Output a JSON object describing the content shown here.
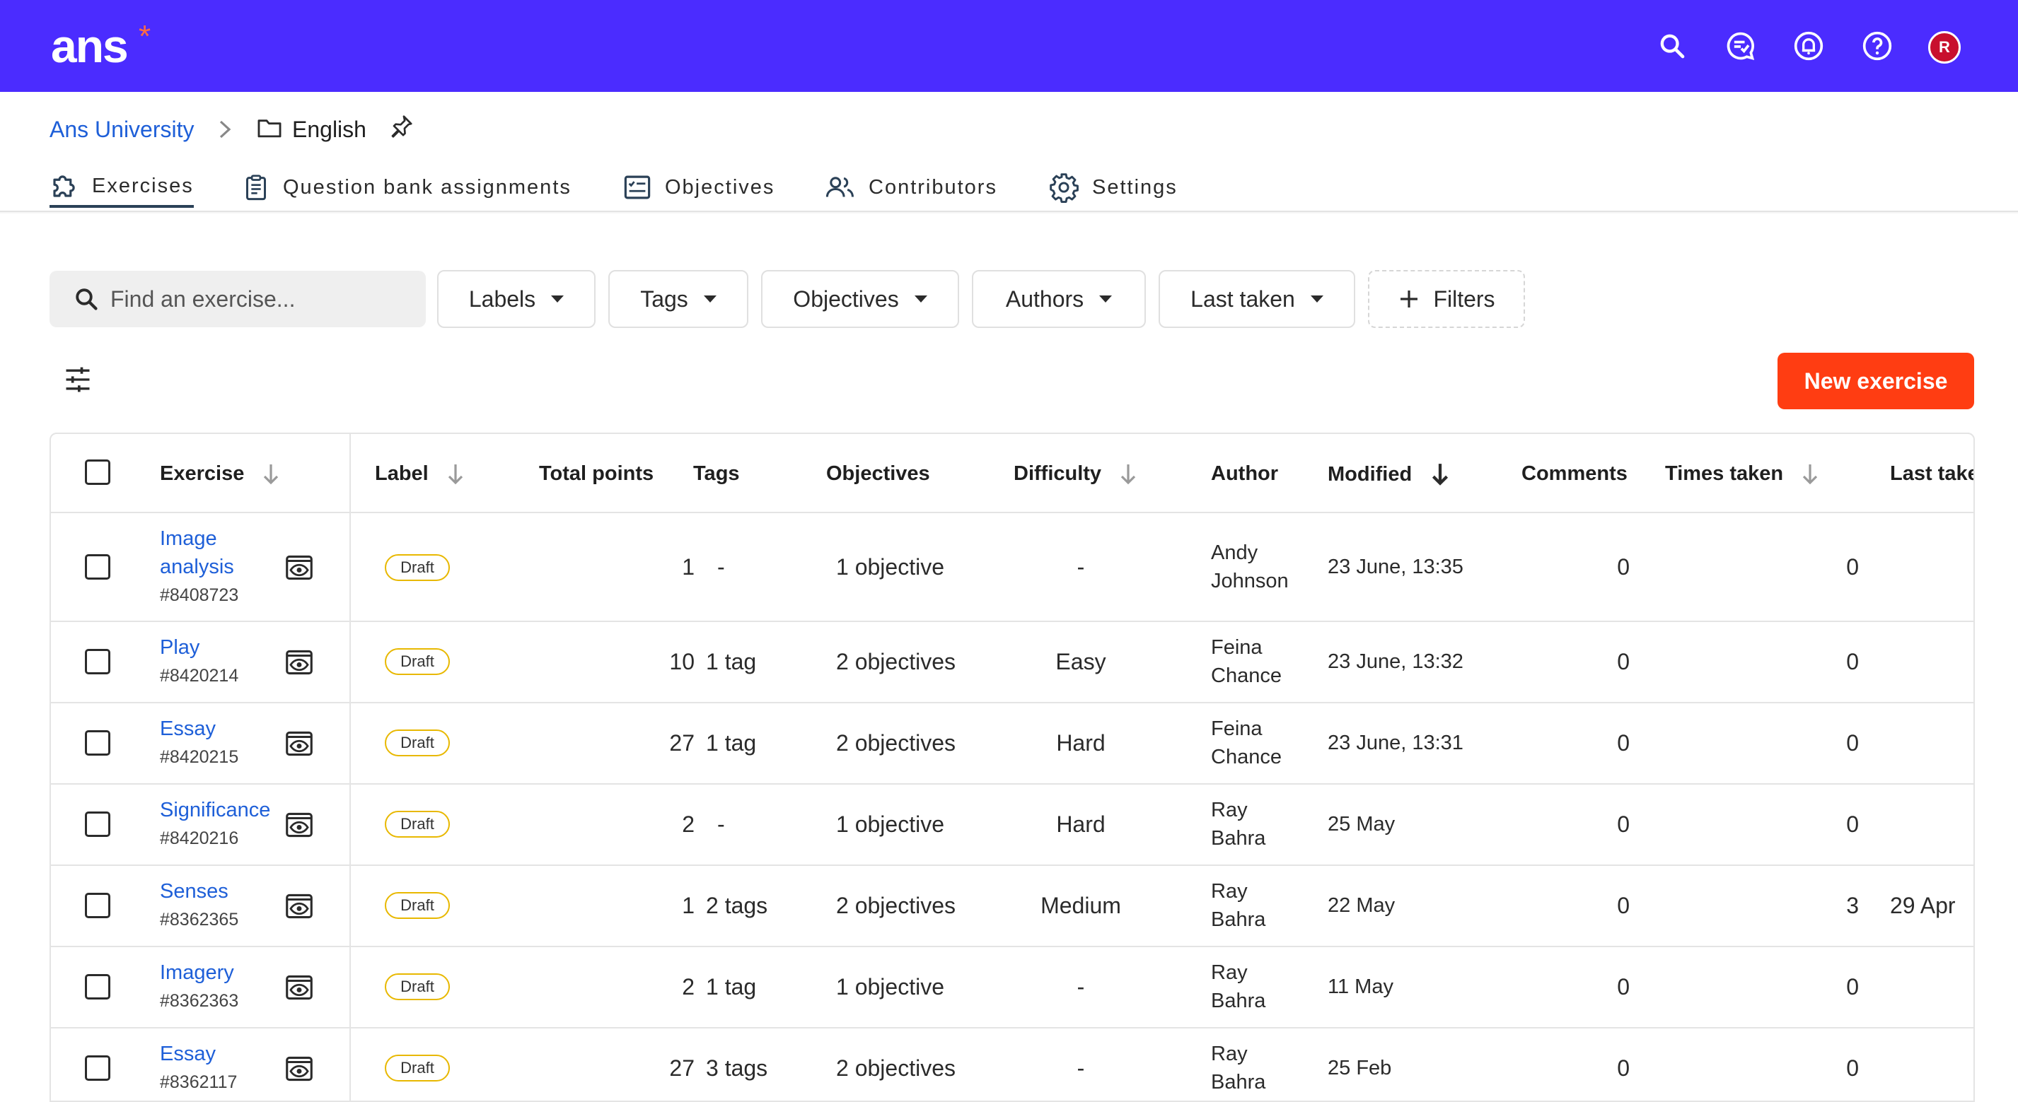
{
  "app": {
    "logo": "ans",
    "logo_mark": "*",
    "user_initial": "R"
  },
  "breadcrumb": {
    "parent": "Ans University",
    "current": "English"
  },
  "tabs": [
    {
      "label": "Exercises",
      "icon": "puzzle-icon",
      "active": true
    },
    {
      "label": "Question bank assignments",
      "icon": "clipboard-icon",
      "active": false
    },
    {
      "label": "Objectives",
      "icon": "checklist-icon",
      "active": false
    },
    {
      "label": "Contributors",
      "icon": "people-icon",
      "active": false
    },
    {
      "label": "Settings",
      "icon": "gear-icon",
      "active": false
    }
  ],
  "search": {
    "placeholder": "Find an exercise..."
  },
  "filters": [
    "Labels",
    "Tags",
    "Objectives",
    "Authors",
    "Last taken",
    "Filters"
  ],
  "new_exercise_label": "New exercise",
  "table": {
    "headers": {
      "exercise": "Exercise",
      "label": "Label",
      "total_points": "Total points",
      "tags": "Tags",
      "objectives": "Objectives",
      "difficulty": "Difficulty",
      "author": "Author",
      "modified": "Modified",
      "comments": "Comments",
      "times_taken": "Times taken",
      "last_taken": "Last take"
    },
    "rows": [
      {
        "title": "Image analysis",
        "id": "#8408723",
        "label": "Draft",
        "points": "1",
        "tags": "-",
        "objectives": "1 objective",
        "difficulty": "-",
        "author": "Andy Johnson",
        "modified": "23 June, 13:35",
        "comments": "0",
        "times_taken": "0",
        "last_taken": ""
      },
      {
        "title": "Play",
        "id": "#8420214",
        "label": "Draft",
        "points": "10",
        "tags": "1 tag",
        "objectives": "2 objectives",
        "difficulty": "Easy",
        "author": "Feina Chance",
        "modified": "23 June, 13:32",
        "comments": "0",
        "times_taken": "0",
        "last_taken": ""
      },
      {
        "title": "Essay",
        "id": "#8420215",
        "label": "Draft",
        "points": "27",
        "tags": "1 tag",
        "objectives": "2 objectives",
        "difficulty": "Hard",
        "author": "Feina Chance",
        "modified": "23 June, 13:31",
        "comments": "0",
        "times_taken": "0",
        "last_taken": ""
      },
      {
        "title": "Significance",
        "id": "#8420216",
        "label": "Draft",
        "points": "2",
        "tags": "-",
        "objectives": "1 objective",
        "difficulty": "Hard",
        "author": "Ray Bahra",
        "modified": "25 May",
        "comments": "0",
        "times_taken": "0",
        "last_taken": ""
      },
      {
        "title": "Senses",
        "id": "#8362365",
        "label": "Draft",
        "points": "1",
        "tags": "2 tags",
        "objectives": "2 objectives",
        "difficulty": "Medium",
        "author": "Ray Bahra",
        "modified": "22 May",
        "comments": "0",
        "times_taken": "3",
        "last_taken": "29 Apr"
      },
      {
        "title": "Imagery",
        "id": "#8362363",
        "label": "Draft",
        "points": "2",
        "tags": "1 tag",
        "objectives": "1 objective",
        "difficulty": "-",
        "author": "Ray Bahra",
        "modified": "11 May",
        "comments": "0",
        "times_taken": "0",
        "last_taken": ""
      },
      {
        "title": "Essay",
        "id": "#8362117",
        "label": "Draft",
        "points": "27",
        "tags": "3 tags",
        "objectives": "2 objectives",
        "difficulty": "-",
        "author": "Ray Bahra",
        "modified": "25 Feb",
        "comments": "0",
        "times_taken": "0",
        "last_taken": ""
      }
    ]
  }
}
